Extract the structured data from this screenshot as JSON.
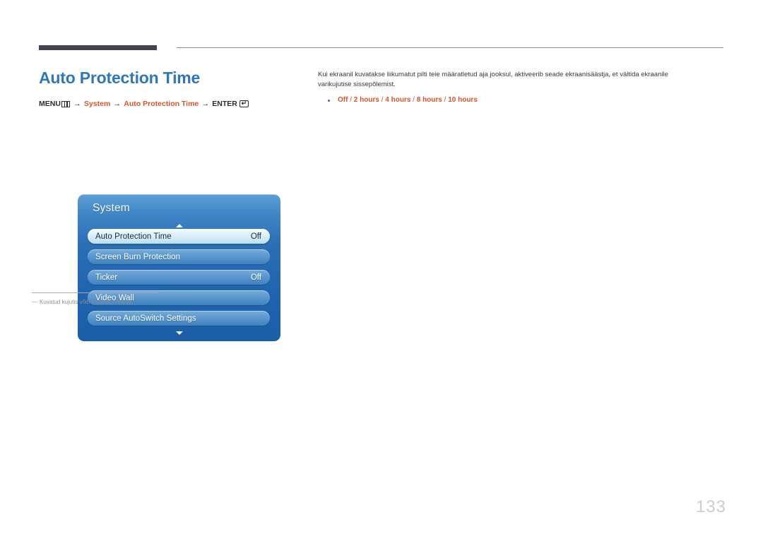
{
  "header": {
    "rule_thick_color": "#45454f",
    "rule_thin_color": "#8d8d97"
  },
  "page": {
    "title": "Auto Protection Time",
    "title_color": "#2f77b8",
    "number": "133"
  },
  "breadcrumb": {
    "menu_label": "MENU",
    "menu_icon": "menu-grid-icon",
    "arrow": "→",
    "item1": "System",
    "item2": "Auto Protection Time",
    "enter_label": "ENTER",
    "enter_icon": "enter-return-icon",
    "enter_glyph": "↵",
    "accent_color": "#d9532c"
  },
  "osd": {
    "title": "System",
    "scroll_up_icon": "triangle-up-icon",
    "scroll_down_icon": "triangle-down-icon",
    "rows": [
      {
        "label": "Auto Protection Time",
        "value": "Off",
        "selected": true
      },
      {
        "label": "Screen Burn Protection",
        "value": "",
        "selected": false
      },
      {
        "label": "Ticker",
        "value": "Off",
        "selected": false
      },
      {
        "label": "Video Wall",
        "value": "",
        "selected": false
      },
      {
        "label": "Source AutoSwitch Settings",
        "value": "",
        "selected": false
      }
    ]
  },
  "footnote": {
    "dash": "―",
    "text": "Kuvatud kujutis võib mudeliti erineda."
  },
  "description": {
    "paragraph": "Kui ekraanil kuvatakse liikumatut pilti teie määratletud aja jooksul, aktiveerib seade ekraanisäästja, et vältida ekraanile varikujutise sissepõlemist.",
    "options": {
      "o1": "Off",
      "s1": " / ",
      "o2": "2 hours",
      "s2": " / ",
      "o3": "4 hours",
      "s3": " / ",
      "o4": "8 hours",
      "s4": " / ",
      "o5": "10 hours"
    }
  }
}
